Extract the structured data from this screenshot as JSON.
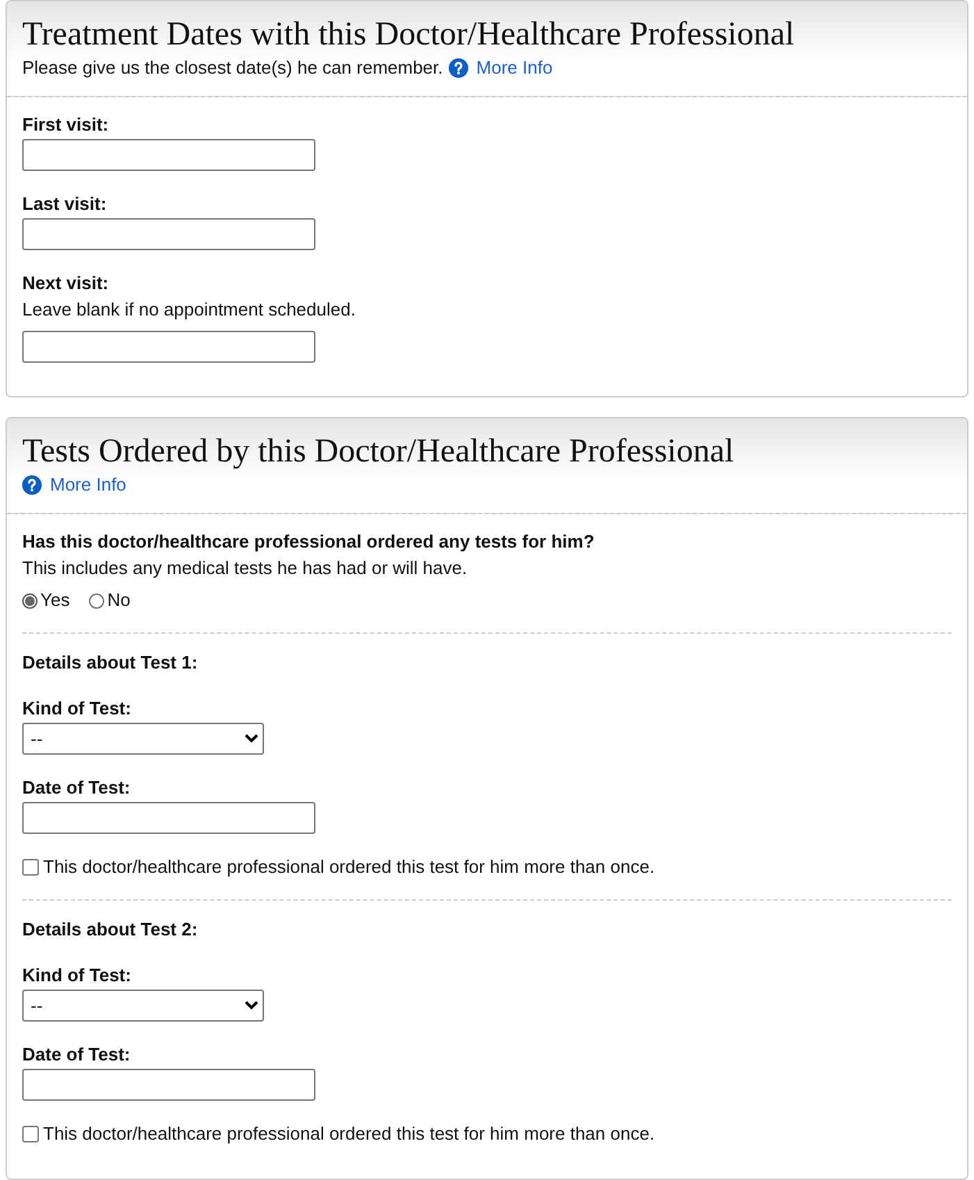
{
  "treatment_dates": {
    "title": "Treatment Dates with this Doctor/Healthcare Professional",
    "subtitle": "Please give us the closest date(s) he can remember.",
    "more_info": "More Info",
    "fields": [
      {
        "label": "First visit:"
      },
      {
        "label": "Last visit:"
      },
      {
        "label": "Next visit:",
        "hint": "Leave blank if no appointment scheduled."
      }
    ]
  },
  "tests_ordered": {
    "title": "Tests Ordered by this Doctor/Healthcare Professional",
    "more_info": "More Info",
    "question": {
      "label": "Has this doctor/healthcare professional ordered any tests for him?",
      "hint": "This includes any medical tests he has had or will have.",
      "options": [
        {
          "label": "Yes",
          "selected": true
        },
        {
          "label": "No",
          "selected": false
        }
      ]
    },
    "tests": [
      {
        "heading": "Details about Test 1:",
        "kind_label": "Kind of Test:",
        "kind_value": "--",
        "date_label": "Date of Test:",
        "repeat_label": "This doctor/healthcare professional ordered this test for him more than once.",
        "repeat_checked": false
      },
      {
        "heading": "Details about Test 2:",
        "kind_label": "Kind of Test:",
        "kind_value": "--",
        "date_label": "Date of Test:",
        "repeat_label": "This doctor/healthcare professional ordered this test for him more than once.",
        "repeat_checked": false
      }
    ]
  }
}
